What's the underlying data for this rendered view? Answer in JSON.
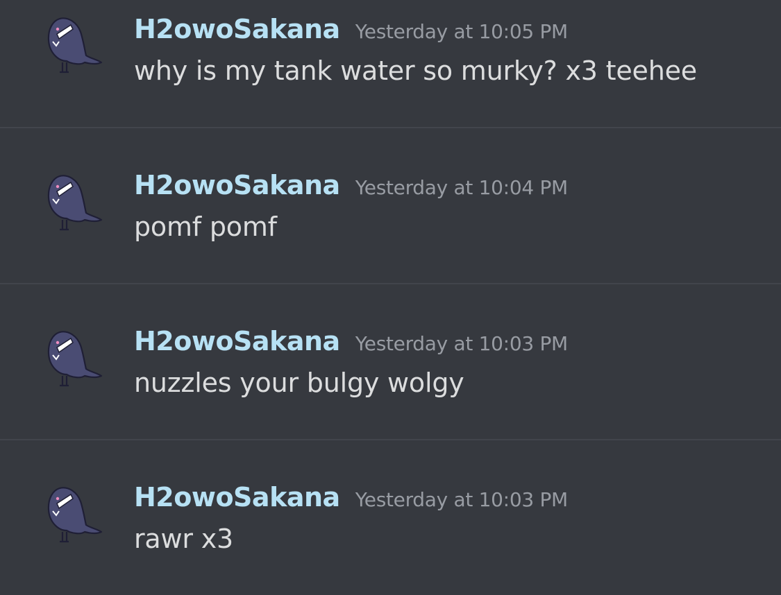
{
  "colors": {
    "background": "#36393f",
    "divider": "#42454c",
    "username": "#b7e1f4",
    "timestamp": "#989ca3",
    "message_text": "#dcddde"
  },
  "avatar_icon": "purple-shark-avatar-icon",
  "messages": [
    {
      "username": "H2owoSakana",
      "timestamp": "Yesterday at 10:05 PM",
      "text": "why is my tank water so murky? x3 teehee"
    },
    {
      "username": "H2owoSakana",
      "timestamp": "Yesterday at 10:04 PM",
      "text": "pomf pomf"
    },
    {
      "username": "H2owoSakana",
      "timestamp": "Yesterday at 10:03 PM",
      "text": "nuzzles your bulgy wolgy"
    },
    {
      "username": "H2owoSakana",
      "timestamp": "Yesterday at 10:03 PM",
      "text": "rawr x3"
    }
  ]
}
